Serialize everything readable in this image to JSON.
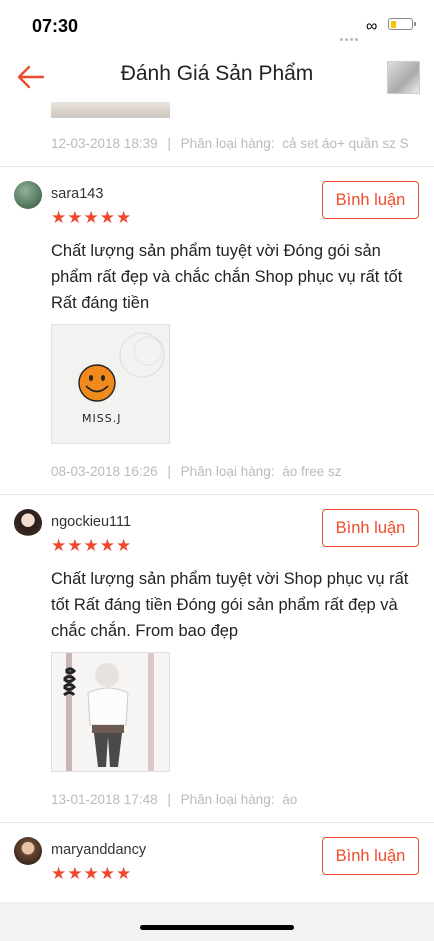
{
  "status_bar": {
    "time": "07:30",
    "battery_level": 0.3
  },
  "header": {
    "title": "Đánh Giá Sản Phẩm",
    "back_icon": "arrow-left-icon",
    "accent": "#ee4d2d"
  },
  "top_review": {
    "date": "12-03-2018 18:39",
    "separator": "|",
    "variant_label": "Phân loại hàng:",
    "variant": "cả set áo+ quần sz S"
  },
  "reviews": [
    {
      "username": "sara143",
      "stars": "★★★★★",
      "rating": 5,
      "button": "Bình luận",
      "text": "Chất lượng sản phẩm tuyệt vời Đóng gói sản phẩm rất đẹp và chắc chắn Shop phục vụ rất tốt Rất đáng tiền",
      "photo_caption": "MISS.J",
      "date": "08-03-2018 16:26",
      "separator": "|",
      "variant_label": "Phân loại hàng:",
      "variant": "áo free sz"
    },
    {
      "username": "ngockieu111",
      "stars": "★★★★★",
      "rating": 5,
      "button": "Bình luận",
      "text": "Chất lượng sản phẩm tuyệt vời Shop phục vụ rất tốt Rất đáng tiền Đóng gói sản phẩm rất đẹp và chắc chắn. From bao đẹp",
      "date": "13-01-2018 17:48",
      "separator": "|",
      "variant_label": "Phân loại hàng:",
      "variant": "áo"
    },
    {
      "username": "maryanddancy",
      "stars": "★★★★★",
      "rating": 5,
      "button": "Bình luận"
    }
  ]
}
